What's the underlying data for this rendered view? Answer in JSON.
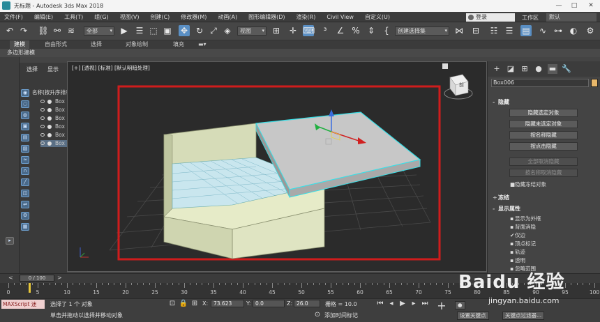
{
  "window": {
    "title": "无标题 - Autodesk 3ds Max 2018",
    "minimize": "—",
    "maximize": "□",
    "close": "✕"
  },
  "menu": [
    "文件(F)",
    "编辑(E)",
    "工具(T)",
    "组(G)",
    "视图(V)",
    "创建(C)",
    "修改器(M)",
    "动画(A)",
    "图形编辑器(D)",
    "渲染(R)",
    "Civil View",
    "自定义(U)"
  ],
  "account": {
    "login": "登录",
    "workspace_label": "工作区",
    "workspace_value": "默认"
  },
  "toolbar": {
    "selection_filter": "全部",
    "view_dropdown": "视图",
    "selection_set": "创建选择集",
    "icons": [
      "undo-icon",
      "redo-icon",
      "link-icon",
      "unlink-icon",
      "bind-spacewarp-icon",
      "select-object-icon",
      "select-by-name-icon",
      "rect-selection-icon",
      "window-crossing-icon",
      "select-move-icon",
      "select-rotate-icon",
      "select-scale-icon",
      "place-icon"
    ]
  },
  "ribbon": {
    "tabs": [
      "建模",
      "自由形式",
      "选择",
      "对象绘制",
      "填充"
    ],
    "active": "建模",
    "sub": "多边形建模"
  },
  "scene_explorer": {
    "tabs": [
      "选择",
      "显示"
    ],
    "column": "名称(按升序排序)",
    "rows": [
      "Box",
      "Box",
      "Box",
      "Box",
      "Box",
      "Box"
    ],
    "selected_index": 5
  },
  "viewport": {
    "label": "[+] [透视] [标准] [默认明暗处理]",
    "view_cube_label": "前"
  },
  "command_panel": {
    "object_name": "Box006",
    "object_color": "#e8b76a",
    "hide_rollout": "隐藏",
    "hide_buttons": [
      "隐藏选定对象",
      "隐藏未选定对象",
      "按名称隐藏",
      "按点击隐藏"
    ],
    "unhide_buttons": [
      "全部取消隐藏",
      "按名称取消隐藏"
    ],
    "hide_frozen": "隐藏冻结对象",
    "freeze_rollout": "冻结",
    "display_props_rollout": "显示属性",
    "display_props": [
      {
        "label": "显示为外框",
        "checked": false
      },
      {
        "label": "背面消隐",
        "checked": false
      },
      {
        "label": "仅边",
        "checked": true
      },
      {
        "label": "顶点标记",
        "checked": false
      },
      {
        "label": "轨迹",
        "checked": false
      },
      {
        "label": "透明",
        "checked": false
      },
      {
        "label": "忽略范围",
        "checked": false
      }
    ]
  },
  "timeline": {
    "slider": "0 / 100",
    "ticks": [
      "0",
      "5",
      "10",
      "15",
      "20",
      "25",
      "30",
      "35",
      "40",
      "45",
      "50",
      "55",
      "60",
      "65",
      "70",
      "75",
      "80",
      "85",
      "90",
      "95",
      "100"
    ],
    "progress_fraction": 0
  },
  "status": {
    "maxscript": "MAXScript 迷",
    "selected": "选择了 1 个 对象",
    "hint": "单击并拖动以选择并移动对象",
    "x_label": "X:",
    "x": "73.623",
    "y_label": "Y:",
    "y": "0.0",
    "z_label": "Z:",
    "z": "26.0",
    "grid": "栅格 = 10.0",
    "add_time_tag": "添加时间标记",
    "set_key": "设置关键点",
    "key_filter": "关键点过滤器..."
  },
  "watermark": {
    "brand": "Baidu 经验",
    "url": "jingyan.baidu.com"
  }
}
